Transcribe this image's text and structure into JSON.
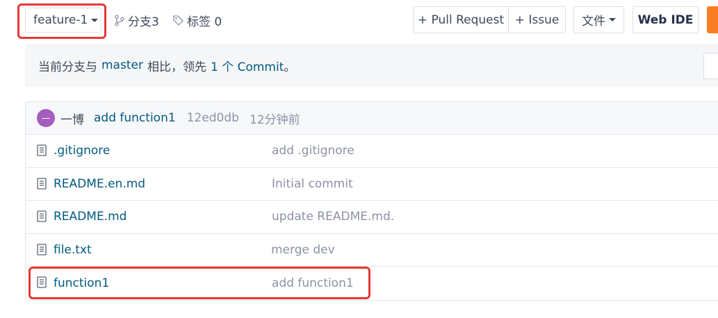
{
  "toolbar": {
    "branch": "feature-1",
    "branches_label": "分支3",
    "tags_label": "标签 0",
    "pull_request_label": "+ Pull Request",
    "issue_label": "+ Issue",
    "file_label": "文件",
    "web_ide_label": "Web IDE"
  },
  "compare": {
    "prefix": "当前分支与",
    "base_branch": "master",
    "middle": "相比，领先",
    "ahead_count": "1 个 Commit",
    "suffix": "。"
  },
  "last_commit": {
    "avatar_text": "一",
    "author": "一博",
    "message": "add function1",
    "sha": "12ed0db",
    "time": "12分钟前"
  },
  "files": [
    {
      "name": ".gitignore",
      "commit": "add .gitignore"
    },
    {
      "name": "README.en.md",
      "commit": "Initial commit"
    },
    {
      "name": "README.md",
      "commit": "update README.md."
    },
    {
      "name": "file.txt",
      "commit": "merge dev"
    },
    {
      "name": "function1",
      "commit": "add function1"
    }
  ],
  "colors": {
    "link": "#005980",
    "accent_orange": "#fa7e23",
    "highlight_red": "#e53935",
    "avatar": "#a55dbf"
  }
}
